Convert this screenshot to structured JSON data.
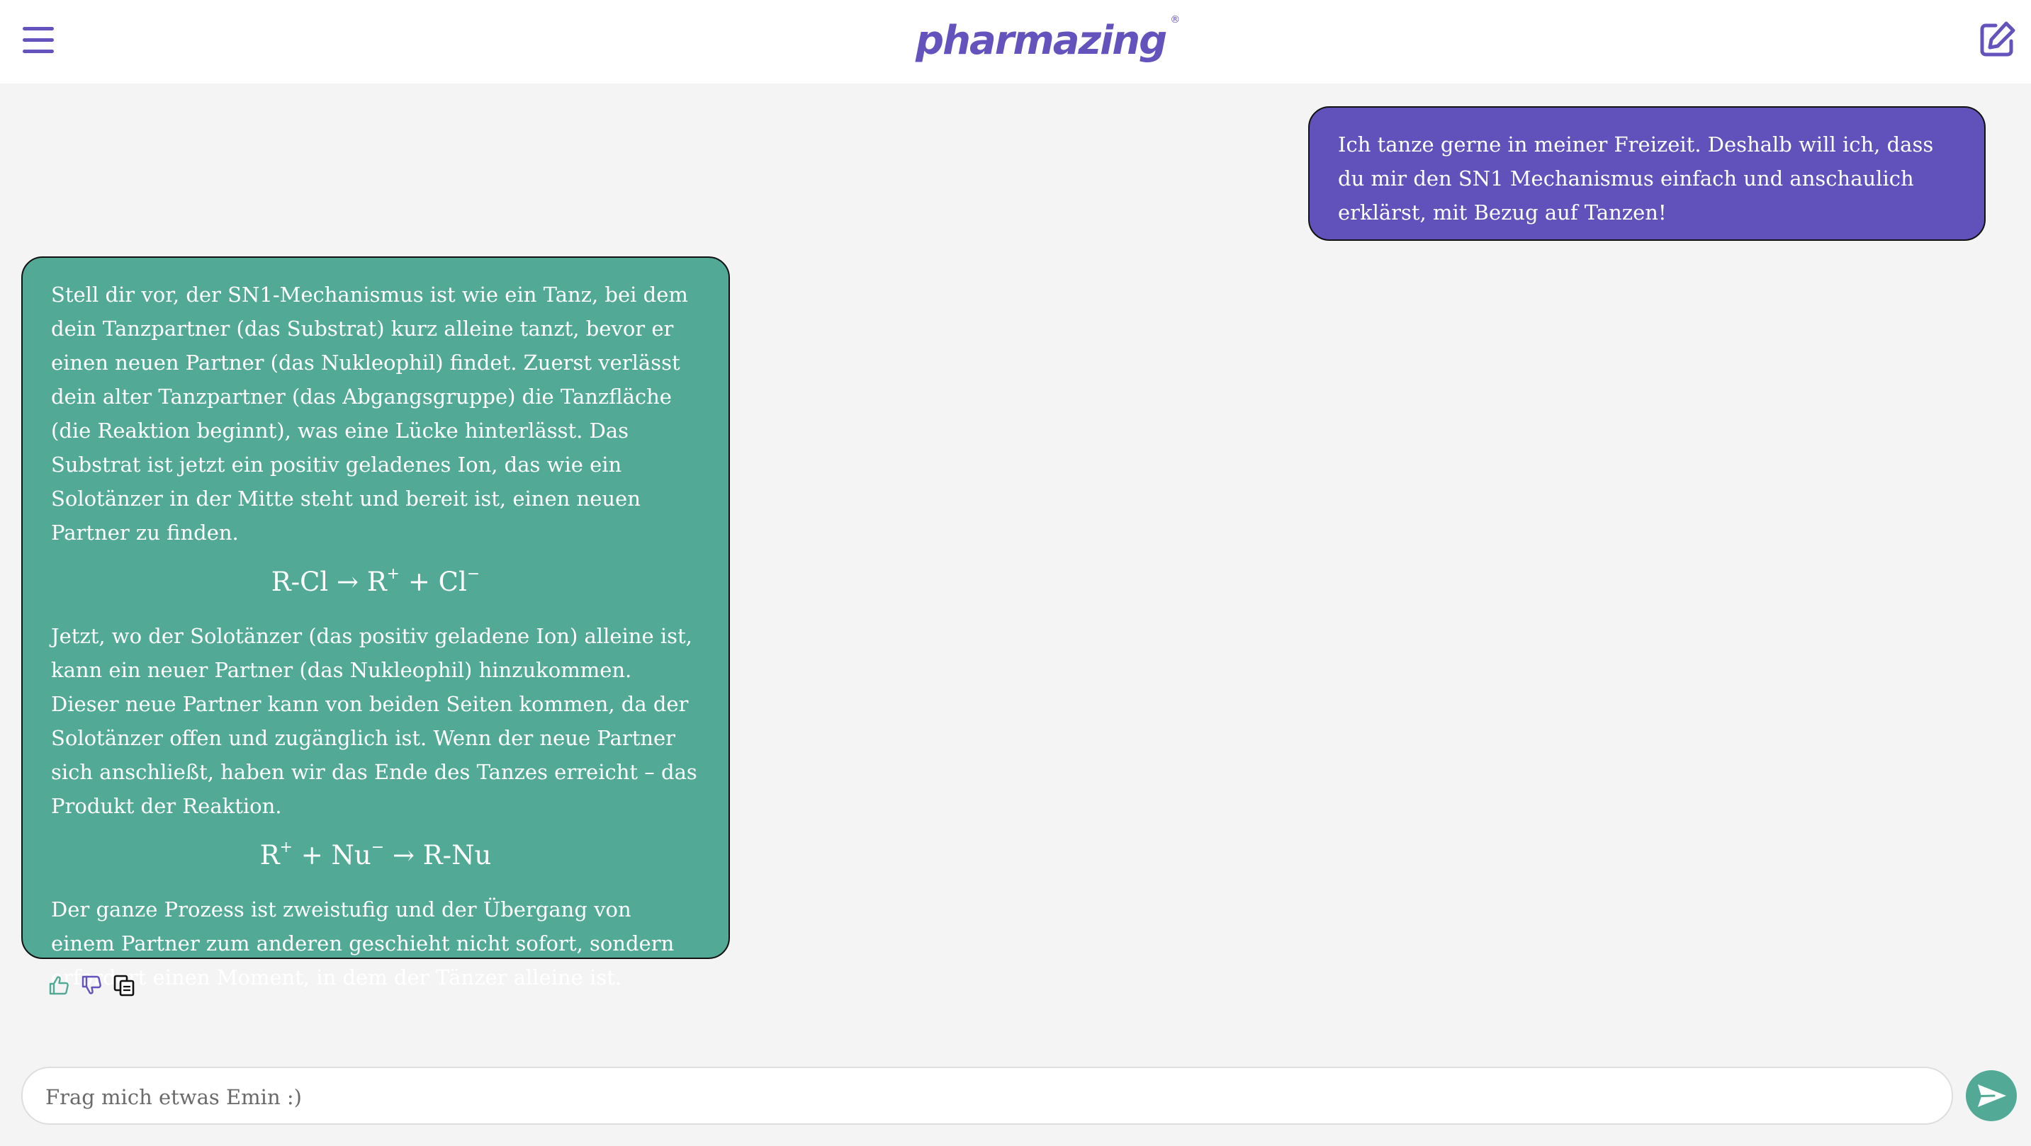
{
  "header": {
    "brand": "pharmazing",
    "brand_mark": "®",
    "menu_icon": "hamburger-menu-icon",
    "new_chat_icon": "edit-icon"
  },
  "colors": {
    "brand": "#6453bd",
    "user_bubble": "#6152bb",
    "bot_bubble": "#52aa96",
    "background": "#f4f4f4"
  },
  "messages": {
    "user": {
      "text": "Ich tanze gerne in meiner Freizeit. Deshalb will ich, dass du mir den SN1 Mechanismus einfach und anschaulich erklärst, mit Bezug auf Tanzen!"
    },
    "assistant": {
      "paragraph_1": "Stell dir vor, der SN1-Mechanismus ist wie ein Tanz, bei dem dein Tanzpartner (das Substrat) kurz alleine tanzt, bevor er einen neuen Partner (das Nukleophil) findet. Zuerst verlässt dein alter Tanzpartner (das Abgangsgruppe) die Tanzfläche (die Reaktion beginnt), was eine Lücke hinterlässt. Das Substrat ist jetzt ein positiv geladenes Ion, das wie ein Solotänzer in der Mitte steht und bereit ist, einen neuen Partner zu finden.",
      "formula_1": {
        "reactant": "R-Cl",
        "arrow": "→",
        "cation": "R",
        "cation_charge": "+",
        "plus": "+",
        "anion": "Cl",
        "anion_charge": "−"
      },
      "paragraph_2": "Jetzt, wo der Solotänzer (das positiv geladene Ion) alleine ist, kann ein neuer Partner (das Nukleophil) hinzukommen. Dieser neue Partner kann von beiden Seiten kommen, da der Solotänzer offen und zugänglich ist. Wenn der neue Partner sich anschließt, haben wir das Ende des Tanzes erreicht – das Produkt der Reaktion.",
      "formula_2": {
        "cation": "R",
        "cation_charge": "+",
        "plus": "+",
        "nucleophile": "Nu",
        "nucleophile_charge": "−",
        "arrow": "→",
        "product": "R-Nu"
      },
      "paragraph_3": "Der ganze Prozess ist zweistufig und der Übergang von einem Partner zum anderen geschieht nicht sofort, sondern erfordert einen Moment, in dem der Tänzer alleine ist."
    }
  },
  "message_actions": [
    "thumbs-up-icon",
    "thumbs-down-icon",
    "copy-icon"
  ],
  "composer": {
    "placeholder": "Frag mich etwas Emin :)",
    "value": "",
    "send_icon": "send-icon"
  }
}
